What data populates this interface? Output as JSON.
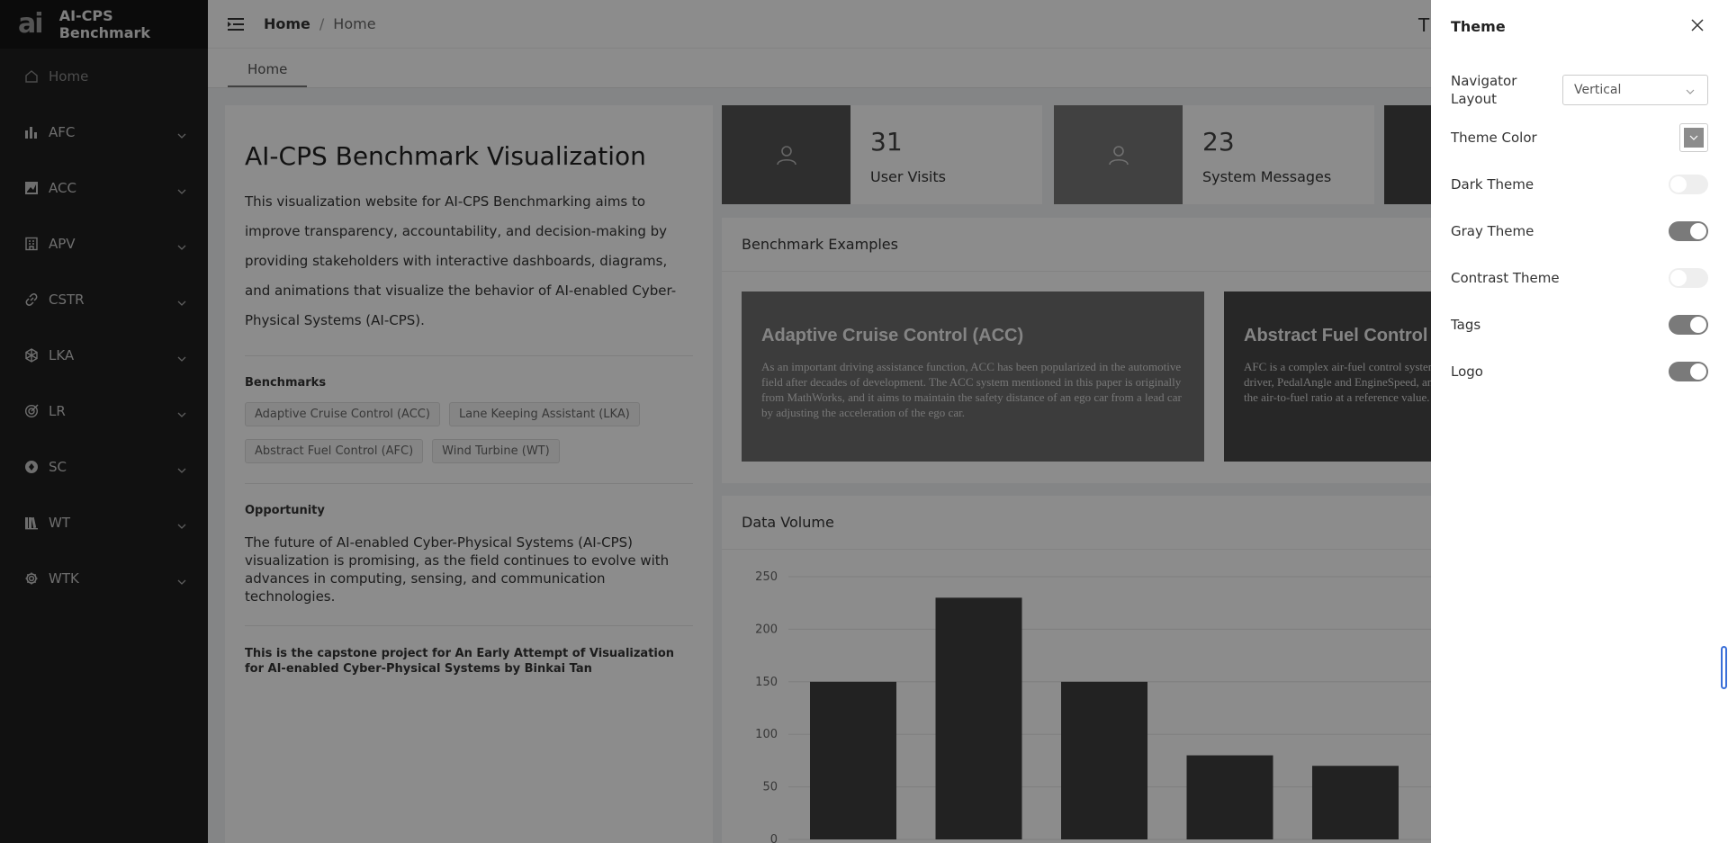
{
  "app": {
    "title": "AI-CPS Benchmark",
    "logo_text": "ai"
  },
  "sidebar": {
    "items": [
      {
        "label": "Home",
        "icon": "home-icon"
      },
      {
        "label": "AFC",
        "icon": "bar-chart-icon"
      },
      {
        "label": "ACC",
        "icon": "area-chart-icon"
      },
      {
        "label": "APV",
        "icon": "building-icon"
      },
      {
        "label": "CSTR",
        "icon": "link-icon"
      },
      {
        "label": "LKA",
        "icon": "network-icon"
      },
      {
        "label": "LR",
        "icon": "target-icon"
      },
      {
        "label": "SC",
        "icon": "aperture-icon"
      },
      {
        "label": "WT",
        "icon": "library-icon"
      },
      {
        "label": "WTK",
        "icon": "gear-icon"
      }
    ]
  },
  "header": {
    "breadcrumb_root": "Home",
    "breadcrumb_sep": "/",
    "breadcrumb_current": "Home",
    "right_icon_glyph": "T"
  },
  "tags_bar": {
    "active_tab": "Home"
  },
  "intro": {
    "title": "AI-CPS Benchmark Visualization",
    "description": "This visualization website for AI-CPS Benchmarking aims to improve transparency, accountability, and decision-making by providing stakeholders with interactive dashboards, diagrams, and animations that visualize the behavior of AI-enabled Cyber-Physical Systems (AI-CPS).",
    "benchmarks_title": "Benchmarks",
    "benchmarks": [
      "Adaptive Cruise Control (ACC)",
      "Lane Keeping Assistant (LKA)",
      "Abstract Fuel Control (AFC)",
      "Wind Turbine (WT)"
    ],
    "opportunity_title": "Opportunity",
    "opportunity_text": "The future of AI-enabled Cyber-Physical Systems (AI-CPS) visualization is promising, as the field continues to evolve with advances in computing, sensing, and communication technologies.",
    "capstone": "This is the capstone project for An Early Attempt of Visualization for AI-enabled Cyber-Physical Systems by Binkai Tan"
  },
  "stats": [
    {
      "value": "31",
      "label": "User Visits"
    },
    {
      "value": "23",
      "label": "System Messages"
    }
  ],
  "examples": {
    "title": "Benchmark Examples",
    "cards": [
      {
        "title": "Adaptive Cruise Control (ACC)",
        "text": "As an important driving assistance function, ACC has been popularized in the automotive field after decades of development. The ACC system mentioned in this paper is originally from MathWorks, and it aims to maintain the safety distance of an ego car from a lead car by adjusting the acceleration of the ego car."
      },
      {
        "title": "Abstract Fuel Control (AFC)",
        "text": "AFC is a complex air-fuel control system. The system takes two input signals from the driver, PedalAngle and EngineSpeed, and outputs parameters to maintain the deviation of the air-to-fuel ratio at a reference value."
      }
    ]
  },
  "volume": {
    "title": "Data Volume"
  },
  "chart_data": {
    "type": "bar",
    "values": [
      150,
      230,
      150,
      80,
      70
    ],
    "ylim": [
      0,
      250
    ],
    "yticks": [
      "0",
      "50",
      "100",
      "150",
      "200",
      "250"
    ],
    "bar_color": "#3f3f3f"
  },
  "drawer": {
    "title": "Theme",
    "navigator_layout_label": "Navigator Layout",
    "navigator_layout_value": "Vertical",
    "theme_color_label": "Theme Color",
    "theme_color_value": "#8c8c8c",
    "dark_theme_label": "Dark Theme",
    "dark_theme_on": false,
    "gray_theme_label": "Gray Theme",
    "gray_theme_on": true,
    "contrast_theme_label": "Contrast Theme",
    "contrast_theme_on": false,
    "tags_label": "Tags",
    "tags_on": true,
    "logo_label": "Logo",
    "logo_on": true
  }
}
